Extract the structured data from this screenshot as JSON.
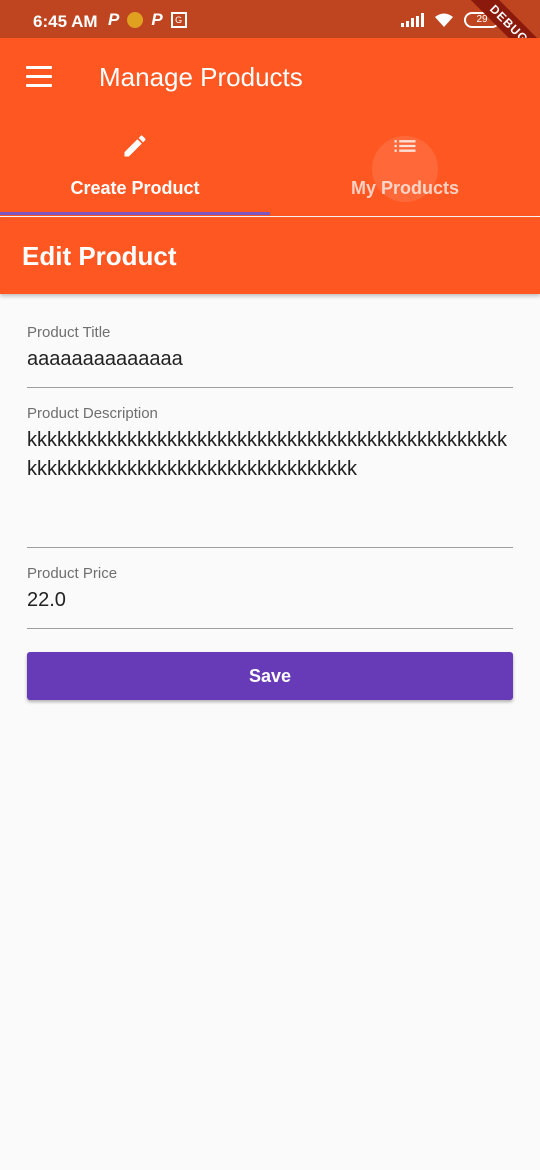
{
  "status_bar": {
    "time": "6:45 AM",
    "left_icons": [
      "P",
      "sun-icon",
      "P",
      "G"
    ],
    "battery": "29",
    "debug_label": "DEBUG"
  },
  "app_bar": {
    "title": "Manage Products",
    "menu_icon": "menu-icon"
  },
  "tabs": [
    {
      "label": "Create Product",
      "icon": "pencil-icon",
      "selected": true
    },
    {
      "label": "My Products",
      "icon": "list-icon",
      "selected": false
    }
  ],
  "edit_bar": {
    "title": "Edit Product"
  },
  "form": {
    "title": {
      "label": "Product Title",
      "value": "aaaaaaaaaaaaaa"
    },
    "description": {
      "label": "Product Description",
      "value": "kkkkkkkkkkkkkkkkkkkkkkkkkkkkkkkkkkkkkkkkkkkkkkkkkkkkkkkkkkkkkkkkkkkkkkkkkkkkkkkkk"
    },
    "price": {
      "label": "Product Price",
      "value": "22.0"
    },
    "save_label": "Save"
  },
  "colors": {
    "primary": "#ff5722",
    "status_bar": "#bf4520",
    "accent": "#673ab7",
    "indicator": "#7e57c2",
    "background": "#fafafa"
  }
}
